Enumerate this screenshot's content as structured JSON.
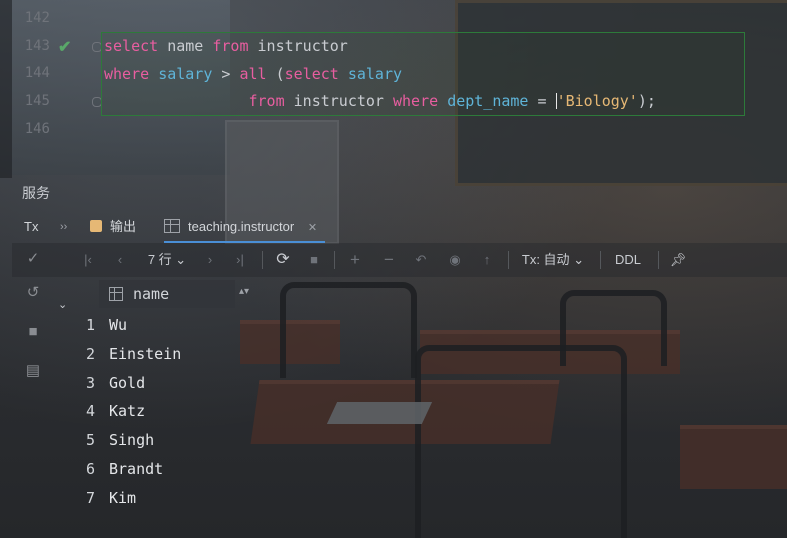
{
  "editor": {
    "line_numbers": [
      "142",
      "143",
      "144",
      "145",
      "146"
    ],
    "lines": [
      [
        {
          "t": "select",
          "c": "kw"
        },
        {
          "t": " name ",
          "c": "fn"
        },
        {
          "t": "from",
          "c": "kw"
        },
        {
          "t": " instructor",
          "c": "fn"
        }
      ],
      [
        {
          "t": "where",
          "c": "kw"
        },
        {
          "t": " ",
          "c": "fn"
        },
        {
          "t": "salary",
          "c": "col"
        },
        {
          "t": " > ",
          "c": "fn"
        },
        {
          "t": "all",
          "c": "kw"
        },
        {
          "t": " (",
          "c": "fn"
        },
        {
          "t": "select",
          "c": "kw"
        },
        {
          "t": " ",
          "c": "fn"
        },
        {
          "t": "salary",
          "c": "col"
        }
      ],
      [
        {
          "t": "                ",
          "c": "fn"
        },
        {
          "t": "from",
          "c": "kw"
        },
        {
          "t": " instructor ",
          "c": "fn"
        },
        {
          "t": "where",
          "c": "kw"
        },
        {
          "t": " ",
          "c": "fn"
        },
        {
          "t": "dept_name",
          "c": "col"
        },
        {
          "t": " = ",
          "c": "fn"
        },
        {
          "t": "CARET",
          "c": "caret"
        },
        {
          "t": "'Biology'",
          "c": "str"
        },
        {
          "t": ");",
          "c": "fn"
        }
      ]
    ]
  },
  "services": {
    "title": "服务",
    "tx_label": "Tx",
    "more": "››",
    "tabs": [
      {
        "label": "输出",
        "icon": "output-icon"
      },
      {
        "label": "teaching.instructor",
        "icon": "table-icon",
        "close": "✕"
      }
    ]
  },
  "toolbar": {
    "row_count": "7 行",
    "tx_mode": "Tx: 自动",
    "ddl": "DDL"
  },
  "grid": {
    "column": "name",
    "rows": [
      {
        "n": "1",
        "name": "Wu"
      },
      {
        "n": "2",
        "name": "Einstein"
      },
      {
        "n": "3",
        "name": "Gold"
      },
      {
        "n": "4",
        "name": "Katz"
      },
      {
        "n": "5",
        "name": "Singh"
      },
      {
        "n": "6",
        "name": "Brandt"
      },
      {
        "n": "7",
        "name": "Kim"
      }
    ]
  },
  "colors": {
    "keyword": "#e85ea0",
    "column": "#5fb4d8",
    "string": "#e6b875",
    "success": "#59a869",
    "accent": "#4a8fd6"
  }
}
